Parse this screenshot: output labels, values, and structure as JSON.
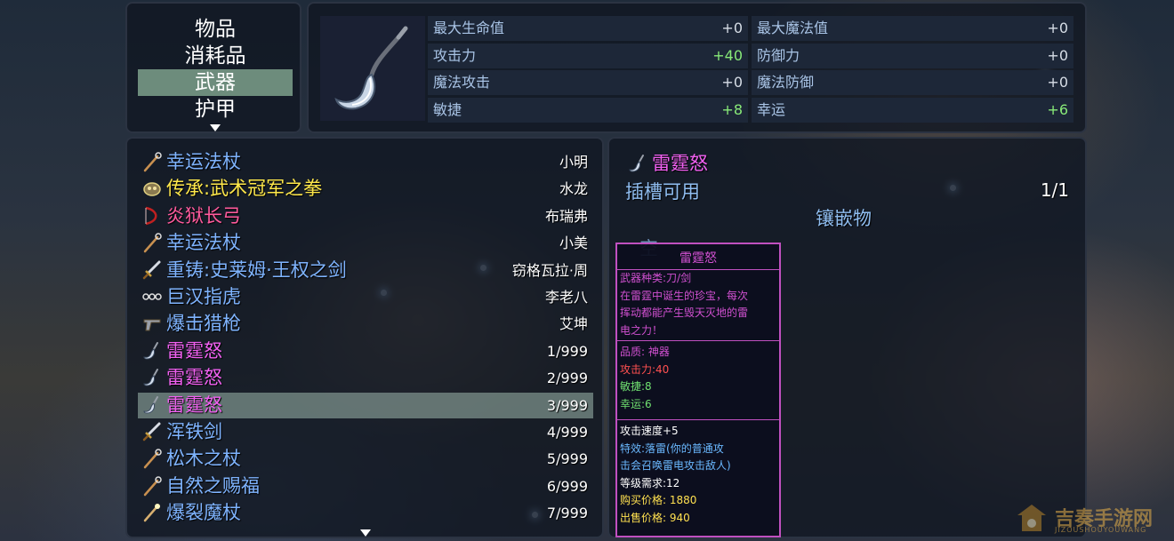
{
  "categories": {
    "items": [
      "物品",
      "消耗品",
      "武器",
      "护甲"
    ],
    "selected_index": 2
  },
  "stats": {
    "left": [
      {
        "label": "最大生命值",
        "value": "+0"
      },
      {
        "label": "攻击力",
        "value": "+40"
      },
      {
        "label": "魔法攻击",
        "value": "+0"
      },
      {
        "label": "敏捷",
        "value": "+8"
      }
    ],
    "right": [
      {
        "label": "最大魔法值",
        "value": "+0"
      },
      {
        "label": "防御力",
        "value": "+0"
      },
      {
        "label": "魔法防御",
        "value": "+0"
      },
      {
        "label": "幸运",
        "value": "+6"
      }
    ]
  },
  "items": [
    {
      "name": "幸运法杖",
      "owner": "小明",
      "color": "#7fb4ff",
      "icon": "staff-icon"
    },
    {
      "name": "传承:武术冠军之拳",
      "owner": "水龙",
      "color": "#ffe84a",
      "icon": "gauntlet-icon"
    },
    {
      "name": "炎狱长弓",
      "owner": "布瑞弗",
      "color": "#ff5a9c",
      "icon": "bow-icon"
    },
    {
      "name": "幸运法杖",
      "owner": "小美",
      "color": "#7fb4ff",
      "icon": "staff-icon"
    },
    {
      "name": "重铸:史莱姆·王权之剑",
      "owner": "窃格瓦拉·周",
      "color": "#7fb4ff",
      "icon": "sword-icon"
    },
    {
      "name": "巨汉指虎",
      "owner": "李老八",
      "color": "#7fb4ff",
      "icon": "knuckle-icon"
    },
    {
      "name": "爆击猎枪",
      "owner": "艾坤",
      "color": "#7fb4ff",
      "icon": "gun-icon"
    },
    {
      "name": "雷霆怒",
      "owner": "1/999",
      "color": "#f060f0",
      "icon": "scythe-icon"
    },
    {
      "name": "雷霆怒",
      "owner": "2/999",
      "color": "#f060f0",
      "icon": "scythe-icon"
    },
    {
      "name": "雷霆怒",
      "owner": "3/999",
      "color": "#f060f0",
      "icon": "scythe-icon"
    },
    {
      "name": "浑铁剑",
      "owner": "4/999",
      "color": "#7fb4ff",
      "icon": "sword-icon"
    },
    {
      "name": "松木之杖",
      "owner": "5/999",
      "color": "#7fb4ff",
      "icon": "staff-icon"
    },
    {
      "name": "自然之赐福",
      "owner": "6/999",
      "color": "#7fb4ff",
      "icon": "staff-icon"
    },
    {
      "name": "爆裂魔杖",
      "owner": "7/999",
      "color": "#7fb4ff",
      "icon": "wand-icon"
    }
  ],
  "selected_item_index": 9,
  "detail": {
    "name": "雷霆怒",
    "slot_label": "插槽可用",
    "slot_count": "1/1",
    "inlay_label": "镶嵌物",
    "hidden_text": "空"
  },
  "tooltip": {
    "title": "雷霆怒",
    "lines": [
      {
        "text": "武器种类:刀/剑",
        "color": "#d050d0"
      },
      {
        "text": "在雷霆中诞生的珍宝，每次",
        "color": "#d050d0"
      },
      {
        "text": "挥动都能产生毁天灭地的雷",
        "color": "#d050d0"
      },
      {
        "text": "电之力！",
        "color": "#d050d0"
      }
    ],
    "stats": [
      {
        "text": "品质: 神器",
        "color": "#d050d0"
      },
      {
        "text": "攻击力:40",
        "color": "#ff5050"
      },
      {
        "text": "敏捷:8",
        "color": "#70e070"
      },
      {
        "text": "幸运:6",
        "color": "#70e070"
      }
    ],
    "extra": [
      {
        "text": "攻击速度+5",
        "color": "#ffffff"
      },
      {
        "text": "特效:落雷(你的普通攻",
        "color": "#6ab8ff"
      },
      {
        "text": "击会召唤雷电攻击敌人)",
        "color": "#6ab8ff"
      },
      {
        "text": "等级需求:12",
        "color": "#ffffff"
      },
      {
        "text": "购买价格: 1880",
        "color": "#ffe050"
      },
      {
        "text": "出售价格: 940",
        "color": "#ffe050"
      }
    ]
  },
  "watermark": {
    "text": "吉奏手游网",
    "subtext": "JIZOUSHOUYOUWANG"
  }
}
